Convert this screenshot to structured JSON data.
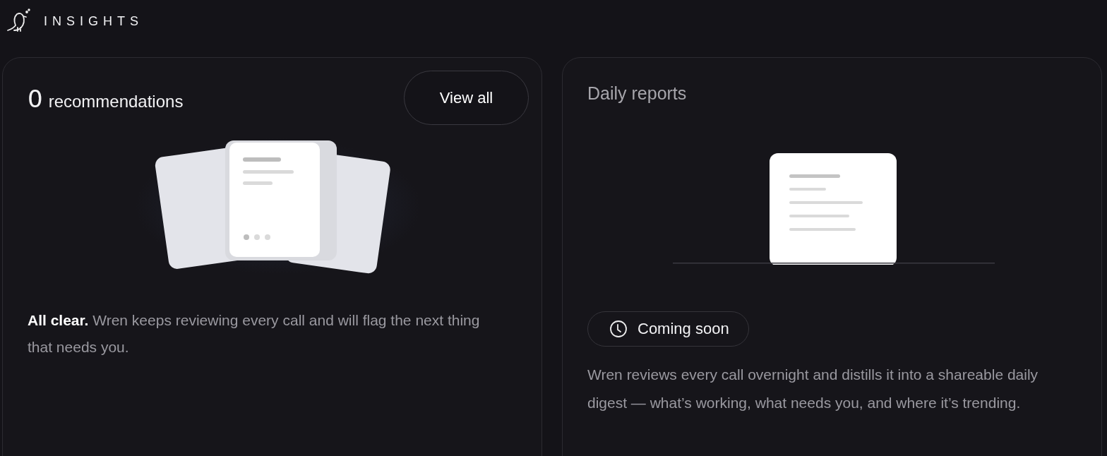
{
  "header": {
    "title": "INSIGHTS"
  },
  "recommendations": {
    "count": "0",
    "label": "recommendations",
    "button": "View all",
    "message": "**All clear.** Wren keeps reviewing every call and will flag the next thing that needs you."
  },
  "daily_reports": {
    "title": "Daily reports",
    "badge": "Coming soon",
    "description": "Wren reviews every call overnight and distills it into a shareable daily digest — what’s working, what needs you, and where it’s trending."
  }
}
